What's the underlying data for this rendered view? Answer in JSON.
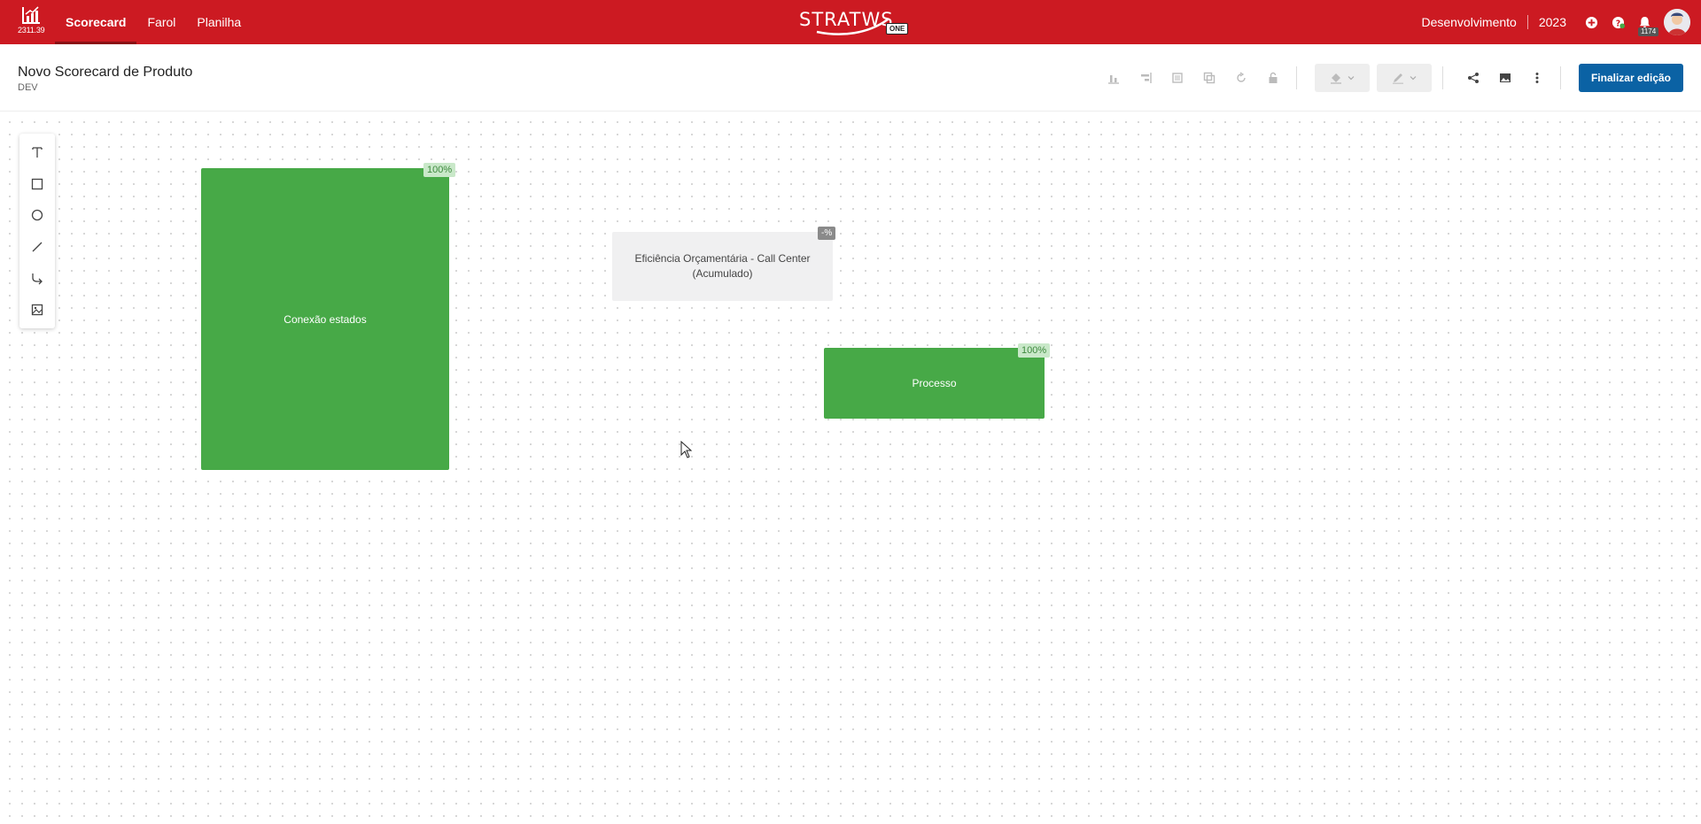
{
  "topbar": {
    "version": "2311.39",
    "nav": [
      {
        "label": "Scorecard",
        "active": true
      },
      {
        "label": "Farol",
        "active": false
      },
      {
        "label": "Planilha",
        "active": false
      }
    ],
    "brand": {
      "name": "STRATWS",
      "badge": "ONE"
    },
    "environment": "Desenvolvimento",
    "year": "2023",
    "notifications_count": "1174",
    "bg_color": "#cc1a22"
  },
  "document": {
    "title": "Novo Scorecard de Produto",
    "subtitle": "DEV"
  },
  "toolbar": {
    "icons": [
      "align-bottom-icon",
      "align-right-icon",
      "bring-front-icon",
      "duplicate-icon",
      "rotate-icon",
      "lock-icon"
    ],
    "fill_color_icon": "paint-bucket-icon",
    "stroke_color_icon": "pen-icon",
    "share_icon": "share-icon",
    "image_icon": "image-icon",
    "more_icon": "more-vertical-icon",
    "finish_label": "Finalizar edição",
    "finish_color": "#0b62a4"
  },
  "side_tools": [
    "text-tool-icon",
    "rectangle-tool-icon",
    "ellipse-tool-icon",
    "line-tool-icon",
    "connector-tool-icon",
    "image-tool-icon"
  ],
  "nodes": [
    {
      "label": "Conexão estados",
      "badge": "100%",
      "status": "green"
    },
    {
      "label": "Eficiência Orçamentária - Call Center (Acumulado)",
      "badge": "-%",
      "status": "gray"
    },
    {
      "label": "Processo",
      "badge": "100%",
      "status": "green"
    }
  ],
  "colors": {
    "green": "#47a947",
    "gray": "#f0f0f1"
  }
}
